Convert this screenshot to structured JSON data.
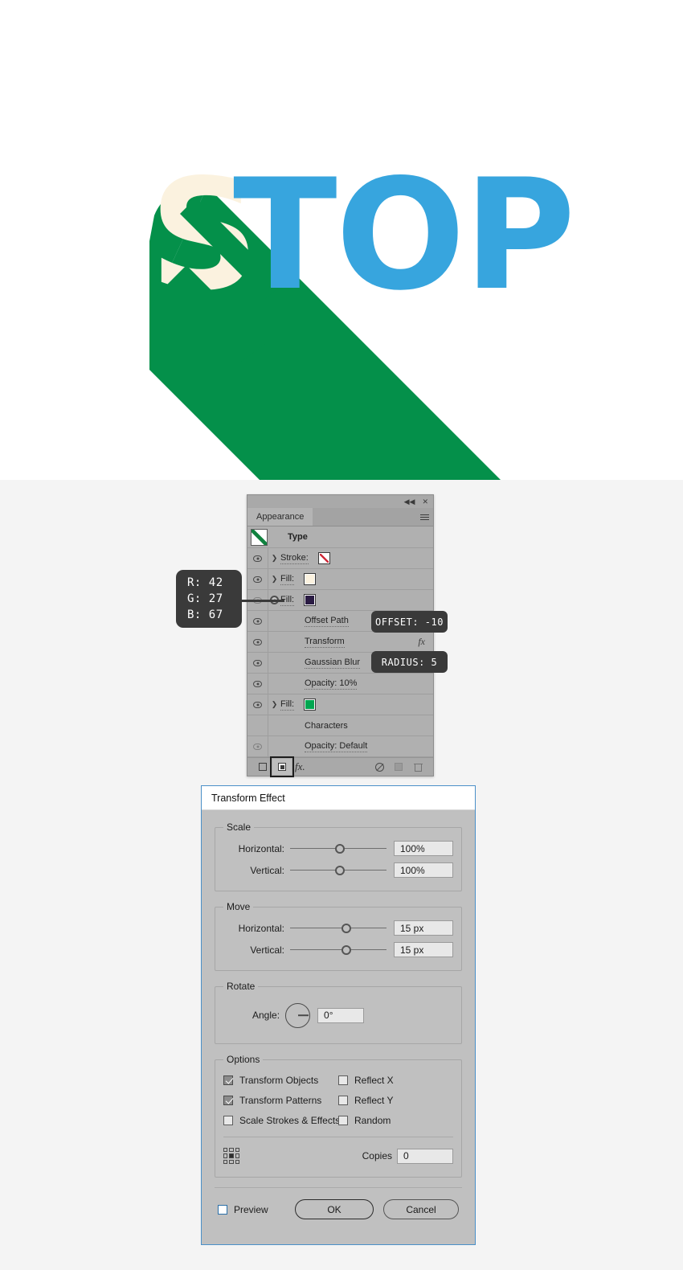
{
  "artwork": {
    "text": "STOP",
    "letter_s_color": "#FBF2DF",
    "letters_top_color": "#37A5DE",
    "shadow_color": "#04904A",
    "background": "#FFFFFF"
  },
  "appearance_panel": {
    "tab_label": "Appearance",
    "collapse_icon": "◀◀",
    "close_icon": "✕",
    "menu_icon": "hamburger-menu-icon",
    "type_row_label": "Type",
    "rows": [
      {
        "label": "Stroke:",
        "swatch": "none",
        "swatch_color": "#FFFFFF",
        "has_arrow": true,
        "eye": true,
        "target": false
      },
      {
        "label": "Fill:",
        "swatch": "solid",
        "swatch_color": "#FBF2DF",
        "has_arrow": true,
        "eye": true,
        "target": false
      },
      {
        "label": "Fill:",
        "swatch": "solid",
        "swatch_color": "#2A1B43",
        "has_arrow": false,
        "eye": true,
        "target": true
      },
      {
        "label": "Offset Path",
        "indent": true,
        "eye": true
      },
      {
        "label": "Transform",
        "indent": true,
        "eye": true,
        "fx": "fx"
      },
      {
        "label": "Gaussian Blur",
        "indent": true,
        "eye": true
      },
      {
        "label": "Opacity:  10%",
        "indent": true,
        "eye": true
      },
      {
        "label": "Fill:",
        "swatch": "solid",
        "swatch_color": "#00A650",
        "has_arrow": true,
        "eye": true,
        "target": false
      },
      {
        "label": "Characters",
        "indent": true,
        "eye": false
      },
      {
        "label": "Opacity:  Default",
        "indent": true,
        "eye": true,
        "eye_dim": true
      }
    ],
    "footer": {
      "new_stroke_icon": "new-stroke-icon",
      "new_fill_icon": "new-fill-icon",
      "fx_icon": "fx.",
      "clear_icon": "clear-appearance-icon",
      "duplicate_icon": "duplicate-item-icon",
      "delete_icon": "trash-icon"
    }
  },
  "callouts": {
    "rgb": {
      "r": "R: 42",
      "g": "G: 27",
      "b": "B: 67"
    },
    "offset": "OFFSET: -10",
    "radius": "RADIUS: 5"
  },
  "dialog": {
    "title": "Transform Effect",
    "scale": {
      "legend": "Scale",
      "horizontal_label": "Horizontal:",
      "horizontal_value": "100%",
      "horizontal_knob_pct": 47,
      "vertical_label": "Vertical:",
      "vertical_value": "100%",
      "vertical_knob_pct": 47
    },
    "move": {
      "legend": "Move",
      "horizontal_label": "Horizontal:",
      "horizontal_value": "15 px",
      "horizontal_knob_pct": 53,
      "vertical_label": "Vertical:",
      "vertical_value": "15 px",
      "vertical_knob_pct": 53
    },
    "rotate": {
      "legend": "Rotate",
      "angle_label": "Angle:",
      "angle_value": "0°"
    },
    "options": {
      "legend": "Options",
      "checkboxes": [
        {
          "label": "Transform Objects",
          "checked": true
        },
        {
          "label": "Transform Patterns",
          "checked": true
        },
        {
          "label": "Scale Strokes & Effects",
          "checked": false
        },
        {
          "label": "Reflect X",
          "checked": false
        },
        {
          "label": "Reflect Y",
          "checked": false
        },
        {
          "label": "Random",
          "checked": false
        }
      ],
      "anchor_icon": "reference-point-selector-icon",
      "copies_label": "Copies",
      "copies_value": "0"
    },
    "footer": {
      "preview_label": "Preview",
      "preview_checked": false,
      "ok_label": "OK",
      "cancel_label": "Cancel"
    },
    "border_color": "#4A90C8"
  }
}
